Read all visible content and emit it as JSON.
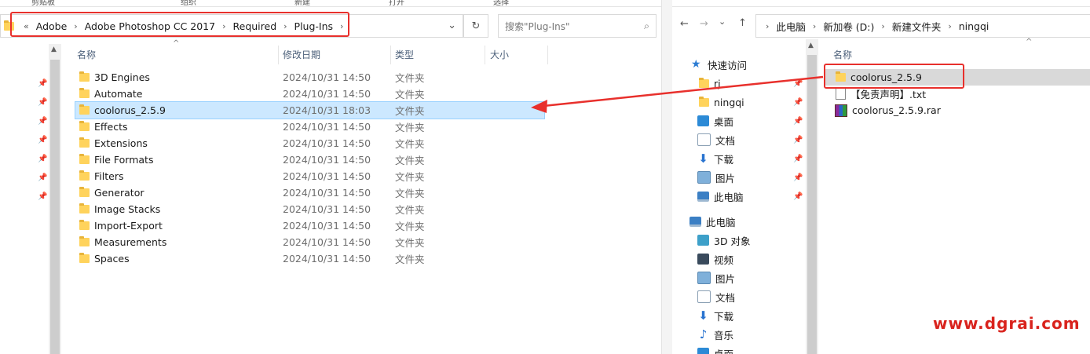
{
  "left": {
    "ribbon": [
      "剪贴板",
      "组织",
      "新建",
      "打开",
      "选择"
    ],
    "breadcrumb": [
      "Adobe",
      "Adobe Photoshop CC 2017",
      "Required",
      "Plug-Ins"
    ],
    "search_placeholder": "搜索\"Plug-Ins\"",
    "columns": {
      "name": "名称",
      "date": "修改日期",
      "type": "类型",
      "size": "大小"
    },
    "rows": [
      {
        "name": "3D Engines",
        "date": "2024/10/31 14:50",
        "type": "文件夹"
      },
      {
        "name": "Automate",
        "date": "2024/10/31 14:50",
        "type": "文件夹"
      },
      {
        "name": "coolorus_2.5.9",
        "date": "2024/10/31 18:03",
        "type": "文件夹"
      },
      {
        "name": "Effects",
        "date": "2024/10/31 14:50",
        "type": "文件夹"
      },
      {
        "name": "Extensions",
        "date": "2024/10/31 14:50",
        "type": "文件夹"
      },
      {
        "name": "File Formats",
        "date": "2024/10/31 14:50",
        "type": "文件夹"
      },
      {
        "name": "Filters",
        "date": "2024/10/31 14:50",
        "type": "文件夹"
      },
      {
        "name": "Generator",
        "date": "2024/10/31 14:50",
        "type": "文件夹"
      },
      {
        "name": "Image Stacks",
        "date": "2024/10/31 14:50",
        "type": "文件夹"
      },
      {
        "name": "Import-Export",
        "date": "2024/10/31 14:50",
        "type": "文件夹"
      },
      {
        "name": "Measurements",
        "date": "2024/10/31 14:50",
        "type": "文件夹"
      },
      {
        "name": "Spaces",
        "date": "2024/10/31 14:50",
        "type": "文件夹"
      }
    ]
  },
  "right": {
    "breadcrumb": [
      "此电脑",
      "新加卷 (D:)",
      "新建文件夹",
      "ningqi"
    ],
    "column_name": "名称",
    "nav": {
      "quick_access": "快速访问",
      "quick_items": [
        "rj",
        "ningqi",
        "桌面",
        "文档",
        "下载",
        "图片",
        "此电脑"
      ],
      "this_pc": "此电脑",
      "pc_items": [
        "3D 对象",
        "视频",
        "图片",
        "文档",
        "下载",
        "音乐",
        "桌面"
      ]
    },
    "files": [
      {
        "name": "coolorus_2.5.9",
        "kind": "folder"
      },
      {
        "name": "【免责声明】.txt",
        "kind": "txt"
      },
      {
        "name": "coolorus_2.5.9.rar",
        "kind": "rar"
      }
    ]
  },
  "watermark": "www.dgrai.com",
  "colors": {
    "annotation": "#e8302c",
    "selection": "#cce8ff",
    "folder": "#ffd35c"
  }
}
